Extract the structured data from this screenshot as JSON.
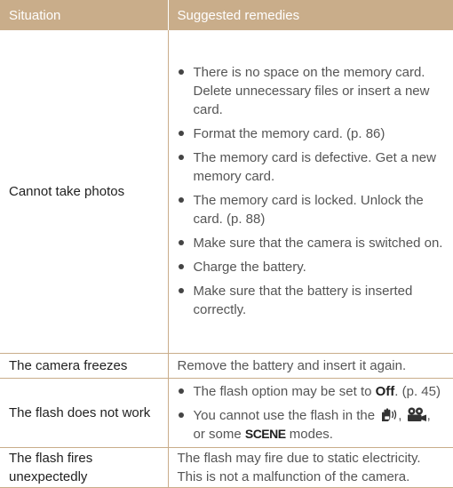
{
  "header": {
    "col1": "Situation",
    "col2": "Suggested remedies"
  },
  "rows": [
    {
      "situation": "Cannot take photos",
      "items": [
        "There is no space on the memory card. Delete unnecessary files or insert a new card.",
        "Format the memory card. (p. 86)",
        "The memory card is defective. Get a new memory card.",
        "The memory card is locked. Unlock the card. (p. 88)",
        "Make sure that the camera is switched on.",
        "Charge the battery.",
        "Make sure that the battery is inserted correctly."
      ]
    },
    {
      "situation": "The camera freezes",
      "text": "Remove the battery and insert it again."
    },
    {
      "situation": "The flash does not work",
      "item1": {
        "before": "The flash option may be set to ",
        "bold": "Off",
        "after": ". (p. 45)"
      },
      "item2": {
        "before": "You cannot use the flash in the ",
        "mid1": ", ",
        "mid2": ", or some ",
        "scene": "SCENE",
        "after": " modes."
      }
    },
    {
      "situation": "The flash fires unexpectedly",
      "text": "The flash may fire due to static electricity. This is not a malfunction of the camera."
    }
  ],
  "icons": {
    "anti_shake": "dual-is-hand-mode-icon",
    "movie": "movie-camera-mode-icon"
  },
  "colors": {
    "header_bg": "#c9ad8a",
    "rule": "#c9ad8a"
  }
}
